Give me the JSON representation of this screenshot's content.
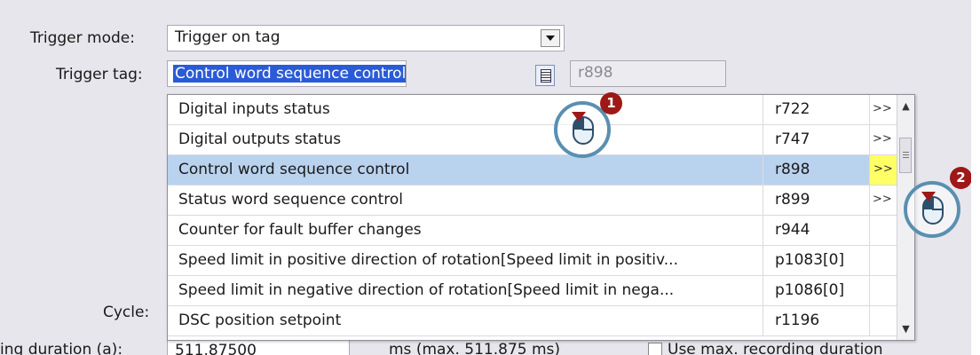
{
  "form": {
    "trigger_mode_label": "Trigger mode:",
    "trigger_mode_value": "Trigger on tag",
    "trigger_tag_label": "Trigger tag:",
    "trigger_tag_value": "Control word sequence control",
    "param_field_value": "r898",
    "cycle_label": "Cycle:",
    "duration_label_partial": "ing duration (a):",
    "duration_value_partial": "511.87500",
    "duration_unit_partial": "ms (max. 511.875 ms)",
    "use_max_partial": "Use max. recording duration"
  },
  "dropdown": {
    "rows": [
      {
        "name": "Digital inputs status",
        "param": "r722",
        "jump": ">>"
      },
      {
        "name": "Digital outputs status",
        "param": "r747",
        "jump": ">>"
      },
      {
        "name": "Control word sequence control",
        "param": "r898",
        "jump": ">>",
        "selected": true
      },
      {
        "name": "Status word sequence control",
        "param": "r899",
        "jump": ">>"
      },
      {
        "name": "Counter for fault buffer changes",
        "param": "r944",
        "jump": ""
      },
      {
        "name": "Speed limit in positive direction of rotation[Speed limit in positiv...",
        "param": "p1083[0]",
        "jump": ""
      },
      {
        "name": "Speed limit in negative direction of rotation[Speed limit in nega...",
        "param": "p1086[0]",
        "jump": ""
      },
      {
        "name": "DSC position setpoint",
        "param": "r1196",
        "jump": ""
      }
    ],
    "scroll_up_icon": "▲",
    "scroll_down_icon": "▼"
  },
  "callouts": {
    "step1": "1",
    "step2": "2"
  },
  "colors": {
    "selected_row": "#b9d2ee",
    "jump_highlight": "#ffff66",
    "badge": "#9e1818",
    "cursor_ring": "#5a8fb0"
  }
}
